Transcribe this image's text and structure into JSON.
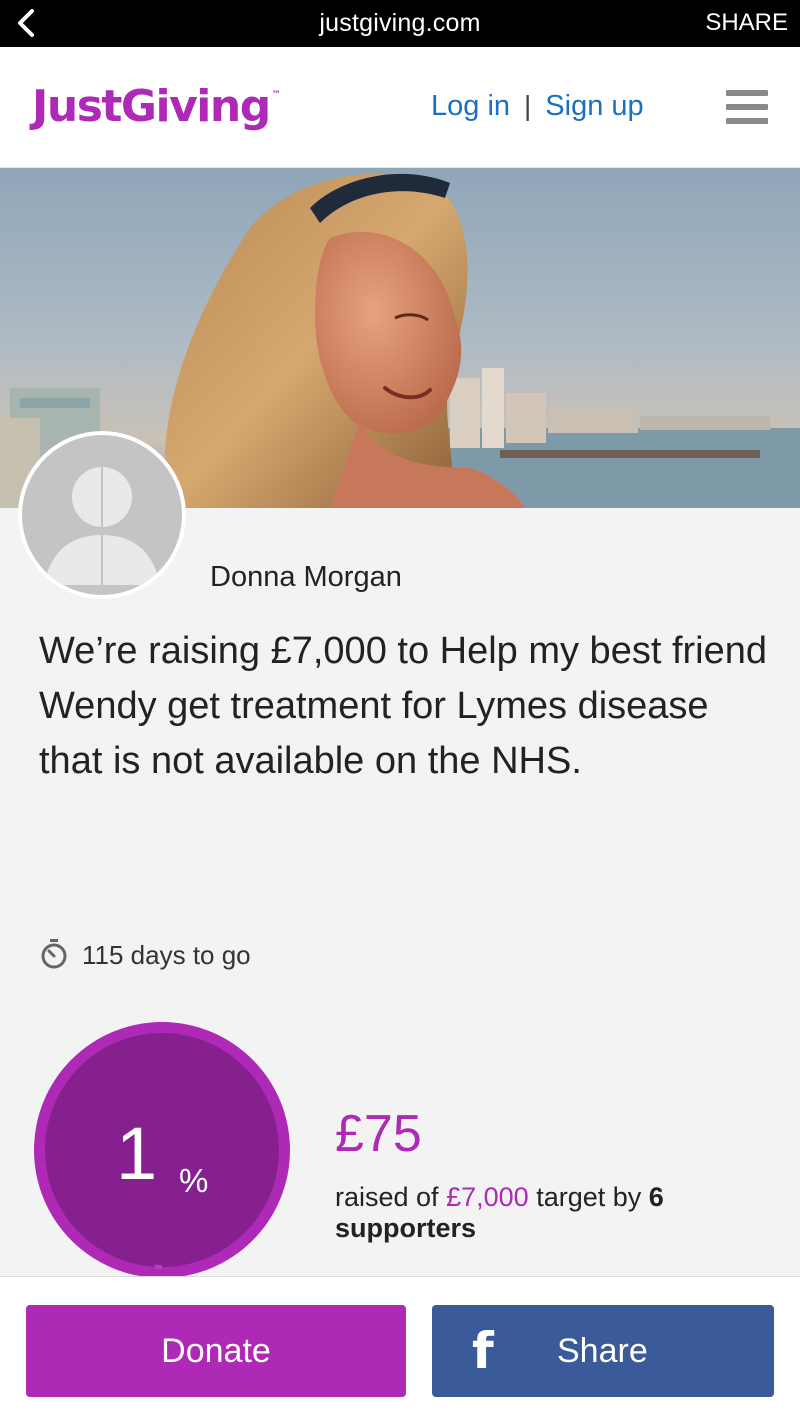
{
  "browser": {
    "url": "justgiving.com",
    "share_label": "SHARE"
  },
  "header": {
    "logo": "JustGiving",
    "logo_tm": "™",
    "login": "Log in",
    "separator": "|",
    "signup": "Sign up"
  },
  "page": {
    "owner_name": "Donna Morgan",
    "headline": "We’re raising £7,000 to Help my best friend Wendy get treatment for Lymes disease that is not available on the NHS.",
    "days_left": "115 days to go"
  },
  "progress": {
    "percent_value": "1",
    "percent_symbol": "%",
    "fraction_raised": 0.01,
    "raised_amount": "£75",
    "raised_prefix": "raised of",
    "target": "£7,000",
    "target_suffix": "target by",
    "supporters_count": "6",
    "supporters_label": "supporters"
  },
  "actions": {
    "donate_label": "Donate",
    "share_label": "Share",
    "facebook_glyph": "f"
  },
  "colors": {
    "brand_purple": "#ad29b6",
    "progress_fill": "#86208f",
    "link_blue": "#1d6fc1",
    "facebook_blue": "#3a5a9a"
  },
  "icons": [
    "back-chevron-icon",
    "hamburger-menu-icon",
    "stopwatch-icon",
    "facebook-icon",
    "default-avatar-icon"
  ]
}
